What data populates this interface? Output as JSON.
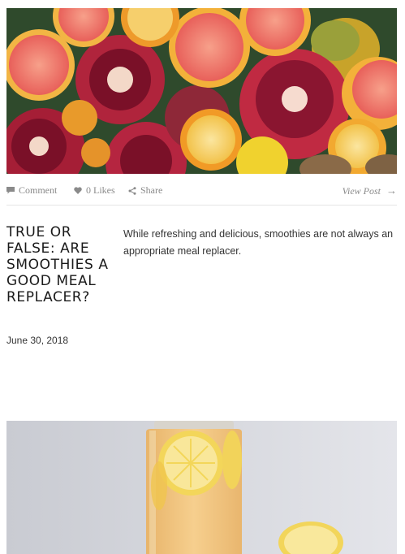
{
  "post": {
    "actions": {
      "comment_label": "Comment",
      "likes_label": "0 Likes",
      "share_label": "Share",
      "view_label": "View Post",
      "view_arrow": "→"
    },
    "title": "TRUE OR FALSE: ARE SMOOTHIES A GOOD MEAL REPLACER?",
    "date": "June 30, 2018",
    "excerpt": "While refreshing and delicious, smoothies are not always an appropriate meal replacer."
  },
  "icons": {
    "comment": "speech-bubble-icon",
    "likes": "heart-icon",
    "share": "share-icon"
  },
  "colors": {
    "action_text": "#8a8a8a",
    "divider": "#e6e6e6",
    "title": "#1a1a1a"
  }
}
